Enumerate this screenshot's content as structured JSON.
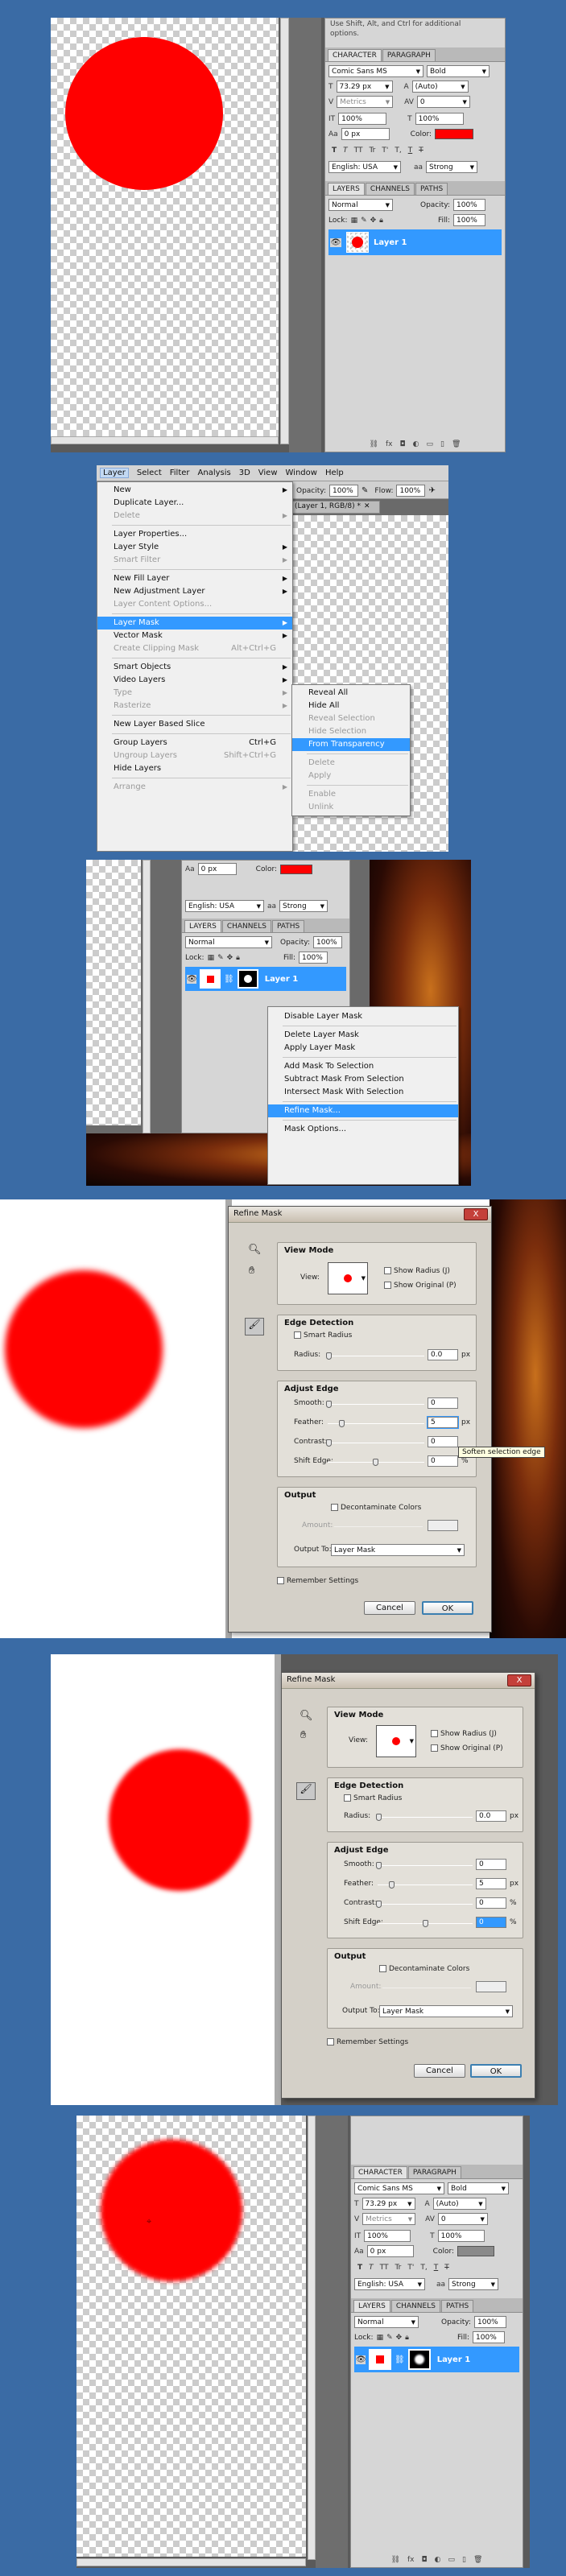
{
  "colors": {
    "accent": "#3399ff",
    "red": "#ff0000",
    "page": "#3a6ba5"
  },
  "s1": {
    "hint": "options.",
    "hint_top": "Use Shift, Alt, and Ctrl for additional",
    "panel_tabs": [
      "CHARACTER",
      "PARAGRAPH"
    ],
    "font_family": "Comic Sans MS",
    "font_style": "Bold",
    "font_size": "73.29 px",
    "leading": "(Auto)",
    "kerning": "Metrics",
    "tracking": "0",
    "vscale": "100%",
    "hscale": "100%",
    "baseline": "0 px",
    "color_label": "Color:",
    "type_buttons": [
      "T",
      "T",
      "TT",
      "Tr",
      "T'",
      "T,",
      "T",
      "T"
    ],
    "language": "English: USA",
    "aa_icon": "aa",
    "aa": "Strong",
    "layer_tabs": [
      "LAYERS",
      "CHANNELS",
      "PATHS"
    ],
    "blend": "Normal",
    "opacity_label": "Opacity:",
    "opacity": "100%",
    "lock_label": "Lock:",
    "fill_label": "Fill:",
    "fill": "100%",
    "layer_name": "Layer 1"
  },
  "s2": {
    "menubar": [
      "Layer",
      "Select",
      "Filter",
      "Analysis",
      "3D",
      "View",
      "Window",
      "Help"
    ],
    "opt_bar": {
      "opacity_label": "Opacity:",
      "opacity": "100%",
      "flow_label": "Flow:",
      "flow": "100%"
    },
    "doc_tab": "(Layer 1, RGB/8) *",
    "menu_items": [
      {
        "label": "New",
        "sub": true
      },
      {
        "label": "Duplicate Layer..."
      },
      {
        "label": "Delete",
        "sub": true,
        "dis": true
      },
      {
        "sep": true
      },
      {
        "label": "Layer Properties..."
      },
      {
        "label": "Layer Style",
        "sub": true
      },
      {
        "label": "Smart Filter",
        "sub": true,
        "dis": true
      },
      {
        "sep": true
      },
      {
        "label": "New Fill Layer",
        "sub": true
      },
      {
        "label": "New Adjustment Layer",
        "sub": true
      },
      {
        "label": "Layer Content Options...",
        "dis": true
      },
      {
        "sep": true
      },
      {
        "label": "Layer Mask",
        "sub": true,
        "hl": true
      },
      {
        "label": "Vector Mask",
        "sub": true
      },
      {
        "label": "Create Clipping Mask",
        "shortcut": "Alt+Ctrl+G",
        "dis": true
      },
      {
        "sep": true
      },
      {
        "label": "Smart Objects",
        "sub": true
      },
      {
        "label": "Video Layers",
        "sub": true
      },
      {
        "label": "Type",
        "sub": true,
        "dis": true
      },
      {
        "label": "Rasterize",
        "sub": true,
        "dis": true
      },
      {
        "sep": true
      },
      {
        "label": "New Layer Based Slice"
      },
      {
        "sep": true
      },
      {
        "label": "Group Layers",
        "shortcut": "Ctrl+G"
      },
      {
        "label": "Ungroup Layers",
        "shortcut": "Shift+Ctrl+G",
        "dis": true
      },
      {
        "label": "Hide Layers"
      },
      {
        "sep": true
      },
      {
        "label": "Arrange",
        "sub": true,
        "dis": true
      }
    ],
    "submenu_items": [
      {
        "label": "Reveal All"
      },
      {
        "label": "Hide All"
      },
      {
        "label": "Reveal Selection",
        "dis": true
      },
      {
        "label": "Hide Selection",
        "dis": true
      },
      {
        "label": "From Transparency",
        "hl": true
      },
      {
        "sep": true
      },
      {
        "label": "Delete",
        "dis": true
      },
      {
        "label": "Apply",
        "dis": true
      },
      {
        "sep": true
      },
      {
        "label": "Enable",
        "dis": true
      },
      {
        "label": "Unlink",
        "dis": true
      }
    ]
  },
  "s3": {
    "baseline": "0 px",
    "color_label": "Color:",
    "language": "English: USA",
    "aa_icon": "aa",
    "aa": "Strong",
    "layer_tabs": [
      "LAYERS",
      "CHANNELS",
      "PATHS"
    ],
    "blend": "Normal",
    "opacity_label": "Opacity:",
    "opacity": "100%",
    "lock_label": "Lock:",
    "fill_label": "Fill:",
    "fill": "100%",
    "layer_name": "Layer 1",
    "context_items": [
      {
        "label": "Disable Layer Mask"
      },
      {
        "sep": true
      },
      {
        "label": "Delete Layer Mask"
      },
      {
        "label": "Apply Layer Mask"
      },
      {
        "sep": true
      },
      {
        "label": "Add Mask To Selection"
      },
      {
        "label": "Subtract Mask From Selection"
      },
      {
        "label": "Intersect Mask With Selection"
      },
      {
        "sep": true
      },
      {
        "label": "Refine Mask...",
        "hl": true
      },
      {
        "sep": true
      },
      {
        "label": "Mask Options..."
      }
    ]
  },
  "dlg1": {
    "title": "Refine Mask",
    "close": "X",
    "view_mode": "View Mode",
    "view_label": "View:",
    "show_radius": "Show Radius (J)",
    "show_original": "Show Original (P)",
    "edge_detection": "Edge Detection",
    "smart_radius": "Smart Radius",
    "radius_label": "Radius:",
    "radius": "0.0",
    "px": "px",
    "adjust_edge": "Adjust Edge",
    "smooth_label": "Smooth:",
    "smooth": "0",
    "feather_label": "Feather:",
    "feather": "5",
    "contrast_label": "Contrast:",
    "contrast": "0",
    "pct": "%",
    "shift_label": "Shift Edge:",
    "shift": "0",
    "output": "Output",
    "decontaminate": "Decontaminate Colors",
    "amount_label": "Amount:",
    "output_to_label": "Output To:",
    "output_to": "Layer Mask",
    "remember": "Remember Settings",
    "cancel": "Cancel",
    "ok": "OK",
    "tooltip": "Soften selection edge"
  },
  "dlg2": {
    "title": "Refine Mask",
    "close": "X",
    "view_mode": "View Mode",
    "view_label": "View:",
    "show_radius": "Show Radius (J)",
    "show_original": "Show Original (P)",
    "edge_detection": "Edge Detection",
    "smart_radius": "Smart Radius",
    "radius_label": "Radius:",
    "radius": "0.0",
    "px": "px",
    "adjust_edge": "Adjust Edge",
    "smooth_label": "Smooth:",
    "smooth": "0",
    "feather_label": "Feather:",
    "feather": "5",
    "contrast_label": "Contrast:",
    "contrast": "0",
    "pct": "%",
    "shift_label": "Shift Edge:",
    "shift": "0",
    "output": "Output",
    "decontaminate": "Decontaminate Colors",
    "amount_label": "Amount:",
    "output_to_label": "Output To:",
    "output_to": "Layer Mask",
    "remember": "Remember Settings",
    "cancel": "Cancel",
    "ok": "OK"
  },
  "s6": {
    "panel_tabs": [
      "CHARACTER",
      "PARAGRAPH"
    ],
    "font_family": "Comic Sans MS",
    "font_style": "Bold",
    "font_size": "73.29 px",
    "leading": "(Auto)",
    "kerning": "Metrics",
    "tracking": "0",
    "vscale": "100%",
    "hscale": "100%",
    "baseline": "0 px",
    "color_label": "Color:",
    "type_buttons": [
      "T",
      "T",
      "TT",
      "Tr",
      "T'",
      "T,",
      "T",
      "T"
    ],
    "language": "English: USA",
    "aa_icon": "aa",
    "aa": "Strong",
    "layer_tabs": [
      "LAYERS",
      "CHANNELS",
      "PATHS"
    ],
    "blend": "Normal",
    "opacity_label": "Opacity:",
    "opacity": "100%",
    "lock_label": "Lock:",
    "fill_label": "Fill:",
    "fill": "100%",
    "layer_name": "Layer 1"
  }
}
